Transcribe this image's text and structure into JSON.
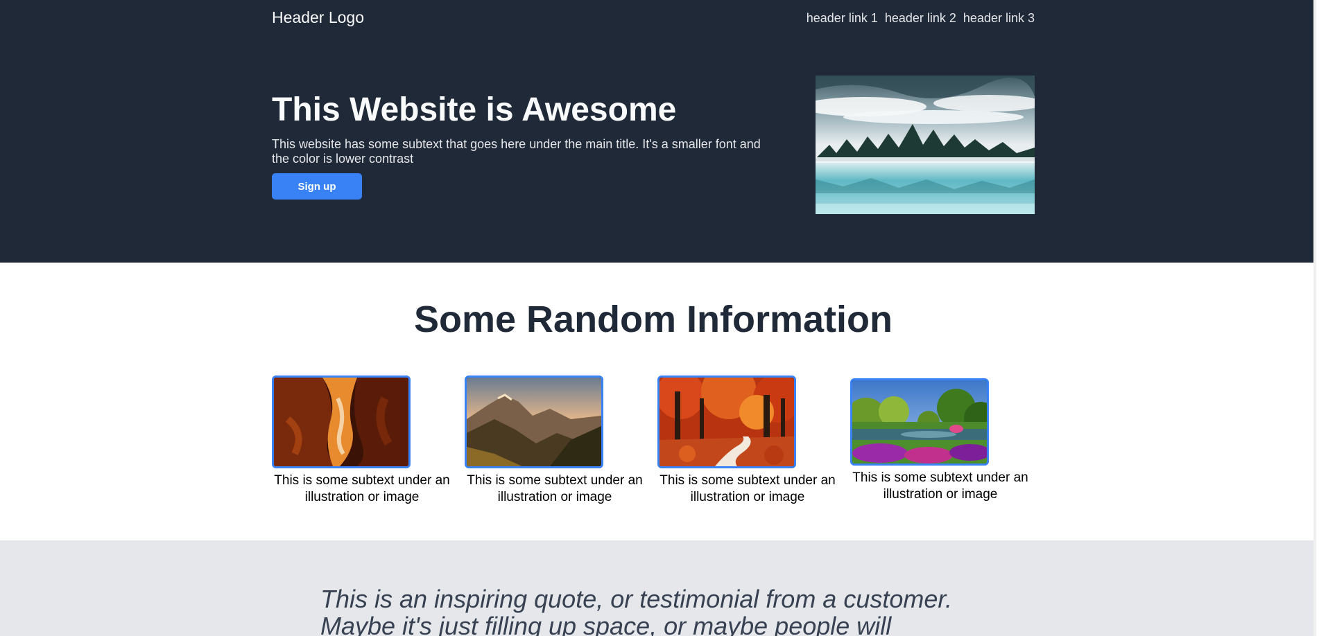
{
  "header": {
    "logo": "Header Logo",
    "links": [
      "header link 1",
      "header link 2",
      "header link 3"
    ]
  },
  "hero": {
    "title": "This Website is Awesome",
    "subtitle": "This website has some subtext that goes here under the main title. It's a smaller font and the color is lower contrast",
    "signup_label": "Sign up",
    "image": "misty-lake-forest-photo"
  },
  "info": {
    "title": "Some Random Information",
    "cards": [
      {
        "image": "canyon-photo",
        "caption": "This is some subtext under an illustration or image"
      },
      {
        "image": "mountain-sunset-photo",
        "caption": "This is some subtext under an illustration or image"
      },
      {
        "image": "autumn-forest-path-photo",
        "caption": "This is some subtext under an illustration or image"
      },
      {
        "image": "garden-pond-photo",
        "caption": "This is some subtext under an illustration or image"
      }
    ]
  },
  "quote": {
    "text": "This is an inspiring quote, or testimonial from a customer. Maybe it's just filling up space, or maybe people will actually"
  },
  "colors": {
    "hero_bg": "#1f2937",
    "accent": "#3882f6",
    "quote_bg": "#e5e7eb"
  }
}
